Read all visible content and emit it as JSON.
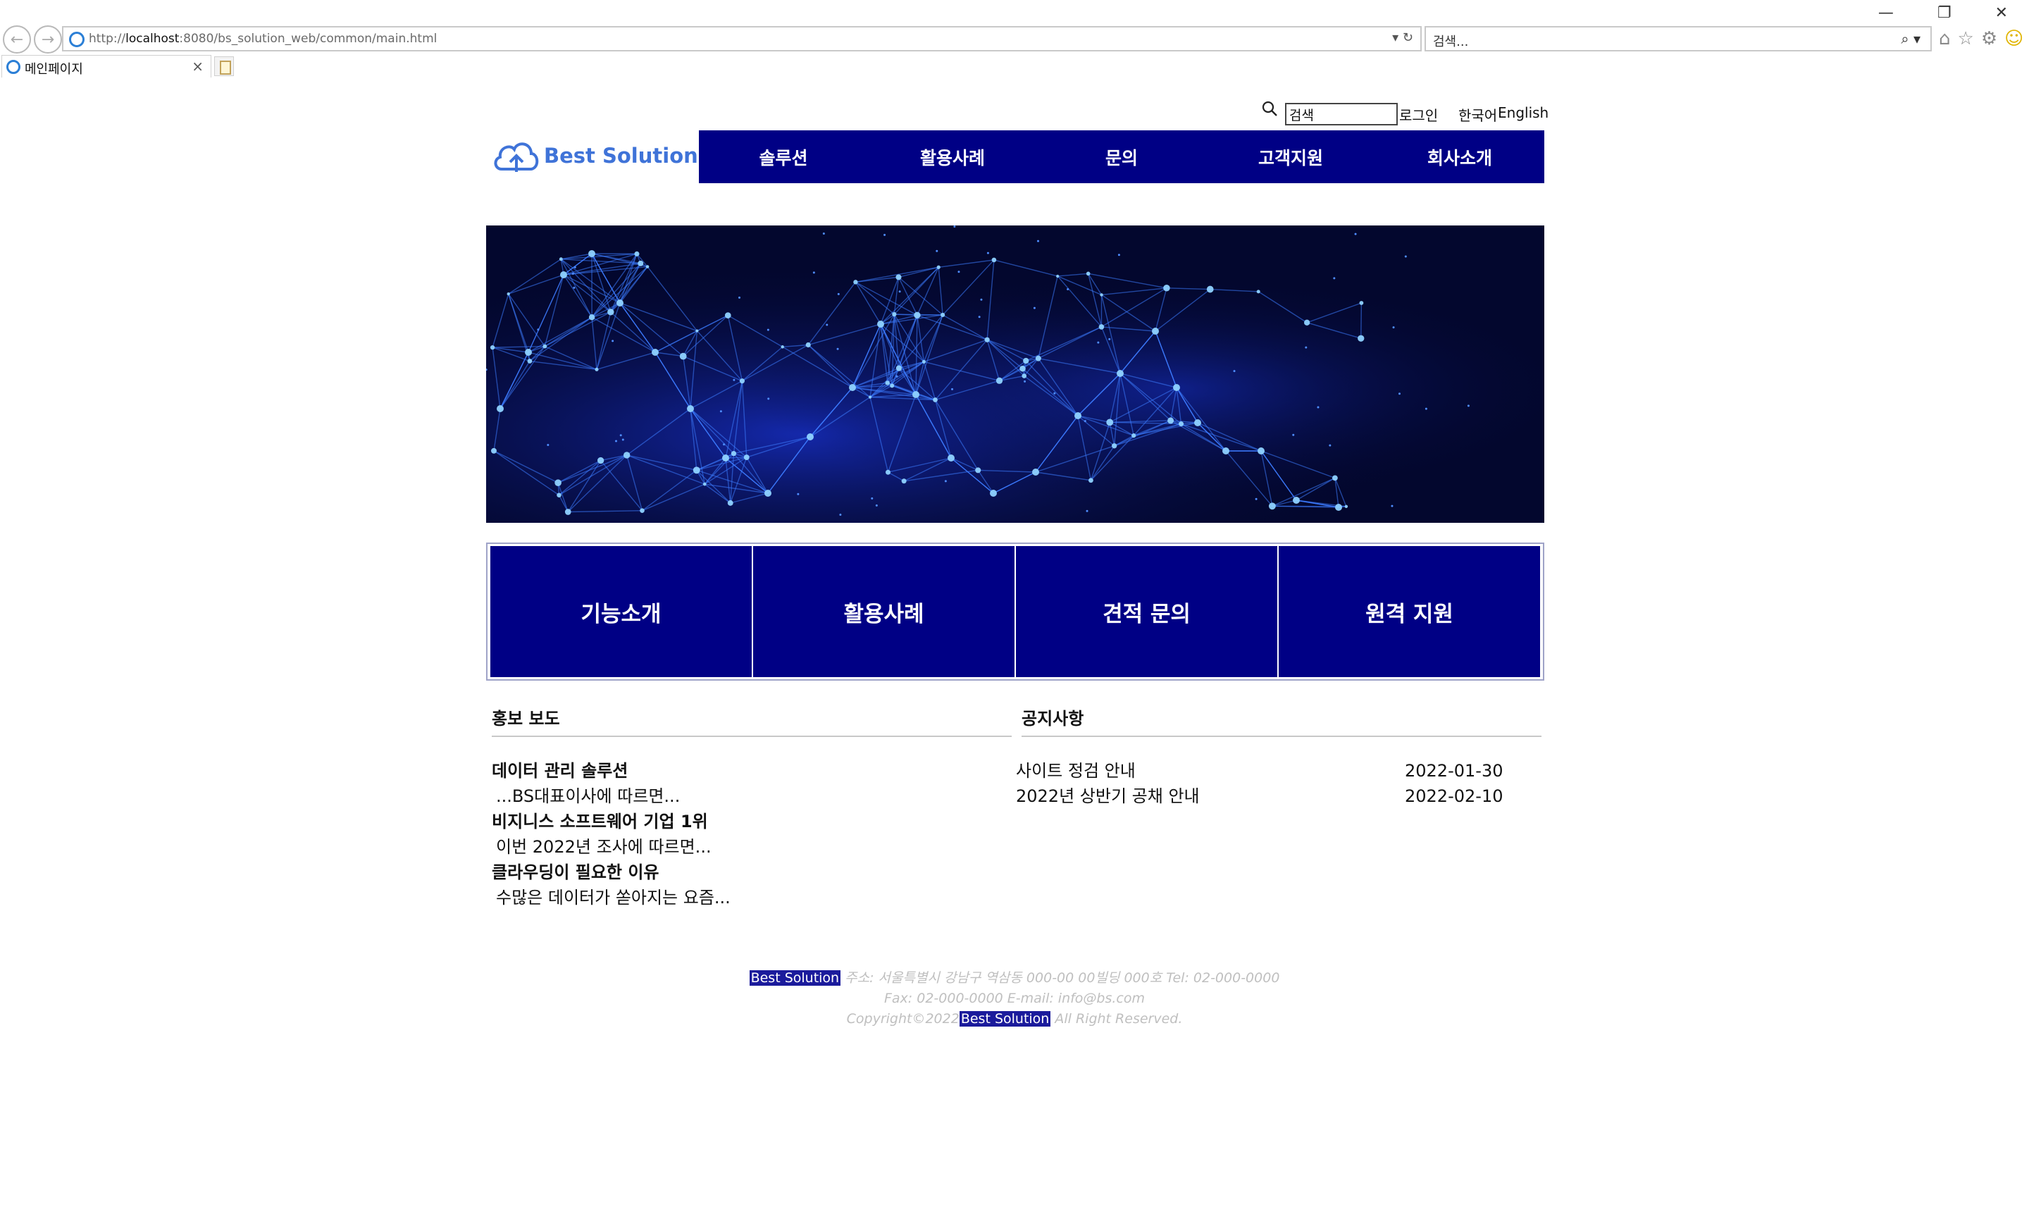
{
  "browser": {
    "url_prefix": "http://",
    "url_host": "localhost",
    "url_rest": ":8080/bs_solution_web/common/main.html",
    "search_placeholder": "검색...",
    "tab_title": "메인페이지",
    "tab_close": "×"
  },
  "header": {
    "search_value": "검색",
    "login_label": "로그인",
    "lang_ko": "한국어",
    "lang_en": "English",
    "logo_text": "Best Solution",
    "logo_color": "#3f73d8"
  },
  "gnb": {
    "items": [
      {
        "label": "솔루션"
      },
      {
        "label": "활용사례"
      },
      {
        "label": "문의"
      },
      {
        "label": "고객지원"
      },
      {
        "label": "회사소개"
      }
    ],
    "bg_color": "#000085"
  },
  "quick_menu": {
    "items": [
      {
        "label": "기능소개"
      },
      {
        "label": "활용사례"
      },
      {
        "label": "견적 문의"
      },
      {
        "label": "원격 지원"
      }
    ]
  },
  "news": {
    "title": "홍보 보도",
    "items": [
      {
        "title": "데이터 관리 솔루션",
        "desc": "...BS대표이사에 따르면..."
      },
      {
        "title": "비지니스 소프트웨어 기업 1위",
        "desc": "이번 2022년 조사에 따르면..."
      },
      {
        "title": "클라우딩이 필요한 이유",
        "desc": "수많은 데이터가 쏟아지는 요즘..."
      }
    ]
  },
  "notice": {
    "title": "공지사항",
    "items": [
      {
        "title": "사이트 정검 안내",
        "date": "2022-01-30"
      },
      {
        "title": "2022년 상반기 공채 안내",
        "date": "2022-02-10"
      }
    ]
  },
  "footer": {
    "brand": "Best Solution",
    "line1_rest": " 주소: 서울특별시 강남구 역삼동 000-00 00빌딩 000호 Tel: 02-000-0000",
    "line2": "Fax: 02-000-0000 E-mail: info@bs.com",
    "line3_prefix": "Copyright©2022",
    "line3_suffix": " All Right Reserved."
  }
}
